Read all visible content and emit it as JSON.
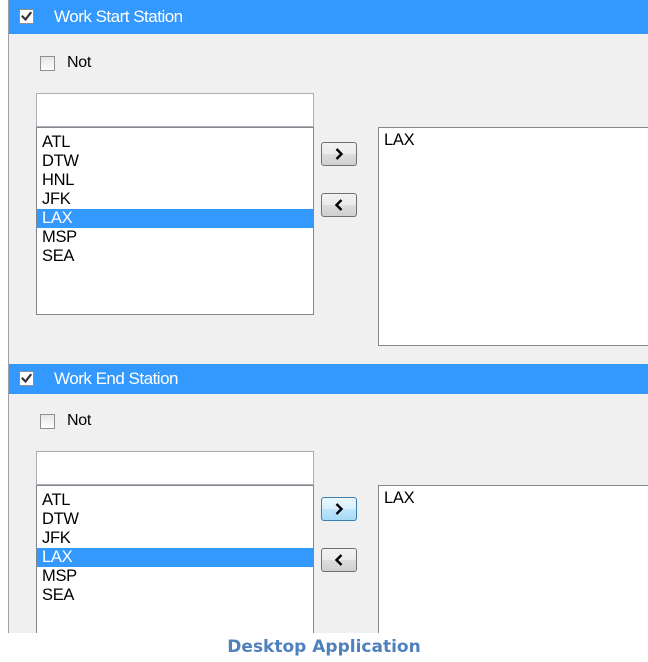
{
  "sections": [
    {
      "title": "Work Start Station",
      "enabled": true,
      "not_label": "Not",
      "not_checked": false,
      "filter_value": "",
      "available": [
        "ATL",
        "DTW",
        "HNL",
        "JFK",
        "LAX",
        "MSP",
        "SEA"
      ],
      "selected_index": 4,
      "add_symbol": ">",
      "remove_symbol": "<",
      "chosen": [
        "LAX"
      ]
    },
    {
      "title": "Work End Station",
      "enabled": true,
      "not_label": "Not",
      "not_checked": false,
      "filter_value": "",
      "available": [
        "ATL",
        "DTW",
        "JFK",
        "LAX",
        "MSP",
        "SEA"
      ],
      "selected_index": 3,
      "add_symbol": ">",
      "remove_symbol": "<",
      "chosen": [
        "LAX"
      ]
    }
  ],
  "caption": "Desktop Application",
  "colors": {
    "accent": "#3399ff",
    "caption": "#4f81bd"
  }
}
